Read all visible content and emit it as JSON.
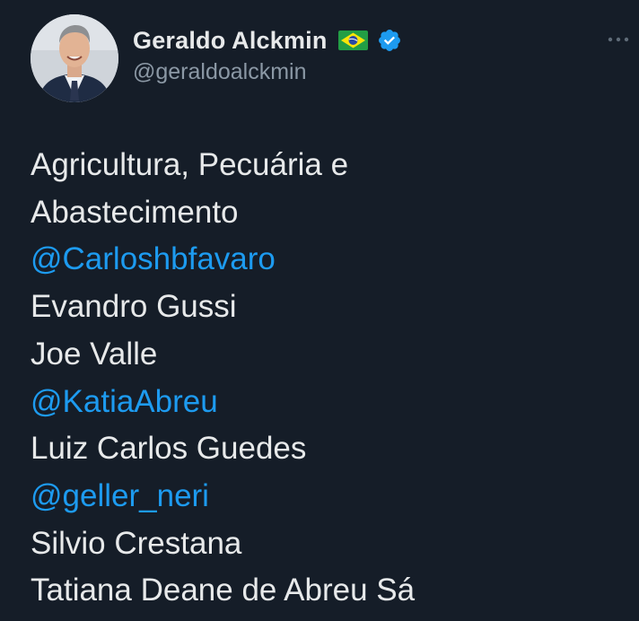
{
  "author": {
    "display_name": "Geraldo Alckmin",
    "handle": "@geraldoalckmin",
    "flag_icon": "brazil-flag-icon",
    "verified_icon": "verified-badge-icon"
  },
  "menu": {
    "icon": "more-options-icon"
  },
  "tweet": {
    "lines": [
      "Agricultura, Pecuária e",
      "Abastecimento",
      "@Carloshbfavaro",
      "Evandro Gussi",
      "Joe Valle",
      "@KatiaAbreu",
      "Luiz Carlos Guedes",
      "@geller_neri",
      "Silvio Crestana",
      "Tatiana Deane de Abreu Sá"
    ]
  },
  "colors": {
    "background": "#151d28",
    "text": "#e7e9ea",
    "handle": "#8b98a5",
    "mention": "#1d9bf0",
    "verified": "#1d9bf0"
  }
}
